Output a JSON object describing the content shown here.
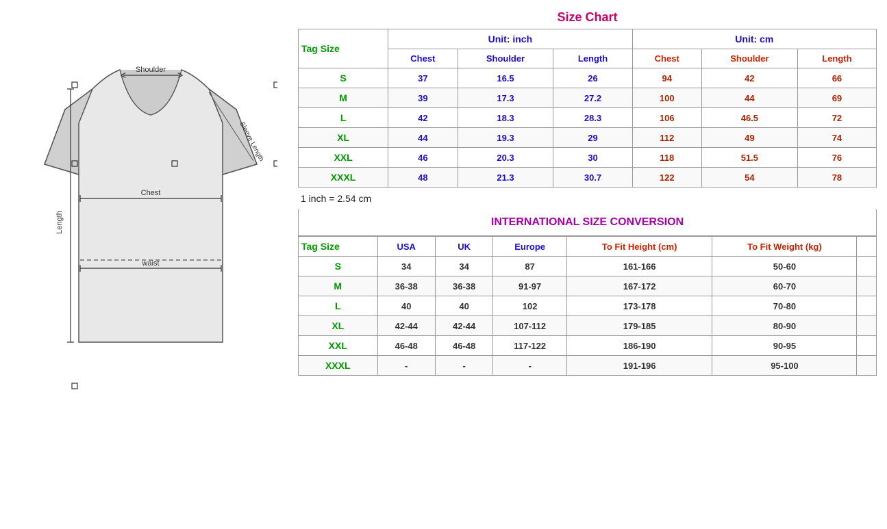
{
  "leftPanel": {
    "diagramAlt": "T-shirt size diagram"
  },
  "sizeChart": {
    "title": "Size Chart",
    "unitInch": "Unit: inch",
    "unitCm": "Unit: cm",
    "tagSizeLabel": "Tag Size",
    "headers": {
      "chest": "Chest",
      "shoulder": "Shoulder",
      "length": "Length"
    },
    "rows": [
      {
        "tag": "S",
        "chest_in": "37",
        "shoulder_in": "16.5",
        "length_in": "26",
        "chest_cm": "94",
        "shoulder_cm": "42",
        "length_cm": "66"
      },
      {
        "tag": "M",
        "chest_in": "39",
        "shoulder_in": "17.3",
        "length_in": "27.2",
        "chest_cm": "100",
        "shoulder_cm": "44",
        "length_cm": "69"
      },
      {
        "tag": "L",
        "chest_in": "42",
        "shoulder_in": "18.3",
        "length_in": "28.3",
        "chest_cm": "106",
        "shoulder_cm": "46.5",
        "length_cm": "72"
      },
      {
        "tag": "XL",
        "chest_in": "44",
        "shoulder_in": "19.3",
        "length_in": "29",
        "chest_cm": "112",
        "shoulder_cm": "49",
        "length_cm": "74"
      },
      {
        "tag": "XXL",
        "chest_in": "46",
        "shoulder_in": "20.3",
        "length_in": "30",
        "chest_cm": "118",
        "shoulder_cm": "51.5",
        "length_cm": "76"
      },
      {
        "tag": "XXXL",
        "chest_in": "48",
        "shoulder_in": "21.3",
        "length_in": "30.7",
        "chest_cm": "122",
        "shoulder_cm": "54",
        "length_cm": "78"
      }
    ],
    "inchNote": "1 inch = 2.54 cm"
  },
  "conversion": {
    "title": "INTERNATIONAL SIZE CONVERSION",
    "tagSizeLabel": "Tag Size",
    "headers": {
      "usa": "USA",
      "uk": "UK",
      "europe": "Europe",
      "toFitHeight": "To Fit Height (cm)",
      "toFitWeight": "To Fit Weight (kg)"
    },
    "toFitLabel": "To Fit",
    "rows": [
      {
        "tag": "S",
        "usa": "34",
        "uk": "34",
        "europe": "87",
        "height": "161-166",
        "weight": "50-60"
      },
      {
        "tag": "M",
        "usa": "36-38",
        "uk": "36-38",
        "europe": "91-97",
        "height": "167-172",
        "weight": "60-70"
      },
      {
        "tag": "L",
        "usa": "40",
        "uk": "40",
        "europe": "102",
        "height": "173-178",
        "weight": "70-80"
      },
      {
        "tag": "XL",
        "usa": "42-44",
        "uk": "42-44",
        "europe": "107-112",
        "height": "179-185",
        "weight": "80-90"
      },
      {
        "tag": "XXL",
        "usa": "46-48",
        "uk": "46-48",
        "europe": "117-122",
        "height": "186-190",
        "weight": "90-95"
      },
      {
        "tag": "XXXL",
        "usa": "-",
        "uk": "-",
        "europe": "-",
        "height": "191-196",
        "weight": "95-100"
      }
    ]
  }
}
